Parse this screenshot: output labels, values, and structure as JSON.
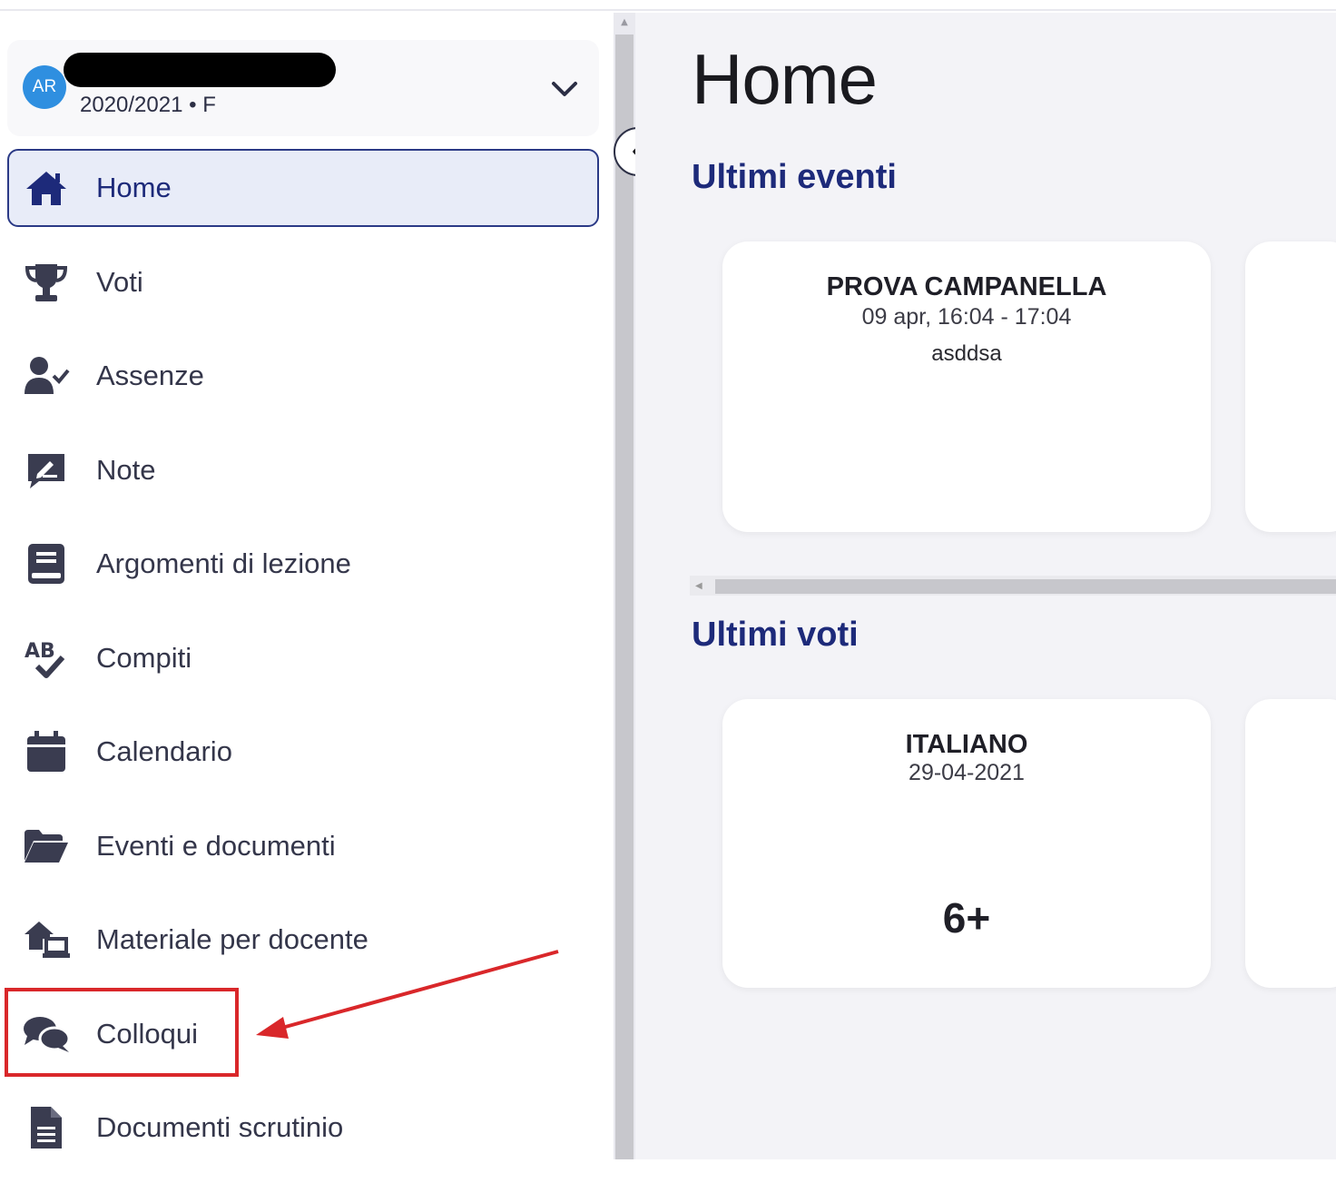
{
  "profile": {
    "initials": "AR",
    "year": "2020/2021 • F"
  },
  "nav": {
    "items": [
      {
        "label": "Home",
        "icon": "home-icon"
      },
      {
        "label": "Voti",
        "icon": "trophy-icon"
      },
      {
        "label": "Assenze",
        "icon": "user-check-icon"
      },
      {
        "label": "Note",
        "icon": "note-icon"
      },
      {
        "label": "Argomenti di lezione",
        "icon": "book-icon"
      },
      {
        "label": "Compiti",
        "icon": "spellcheck-icon"
      },
      {
        "label": "Calendario",
        "icon": "calendar-icon"
      },
      {
        "label": "Eventi e documenti",
        "icon": "folder-open-icon"
      },
      {
        "label": "Materiale per docente",
        "icon": "house-laptop-icon"
      },
      {
        "label": "Colloqui",
        "icon": "comments-icon"
      },
      {
        "label": "Documenti scrutinio",
        "icon": "file-icon"
      }
    ]
  },
  "main": {
    "title": "Home",
    "events_section": "Ultimi eventi",
    "grades_section": "Ultimi voti",
    "event_card": {
      "title": "PROVA CAMPANELLA",
      "time": "09 apr, 16:04 - 17:04",
      "description": "asddsa"
    },
    "grade_card": {
      "subject": "ITALIANO",
      "date": "29-04-2021",
      "grade": "6+"
    }
  },
  "colors": {
    "accent": "#1d2a7a",
    "active_bg": "#e8ecf8",
    "highlight": "#d9272a",
    "avatar": "#2f8fe0"
  }
}
